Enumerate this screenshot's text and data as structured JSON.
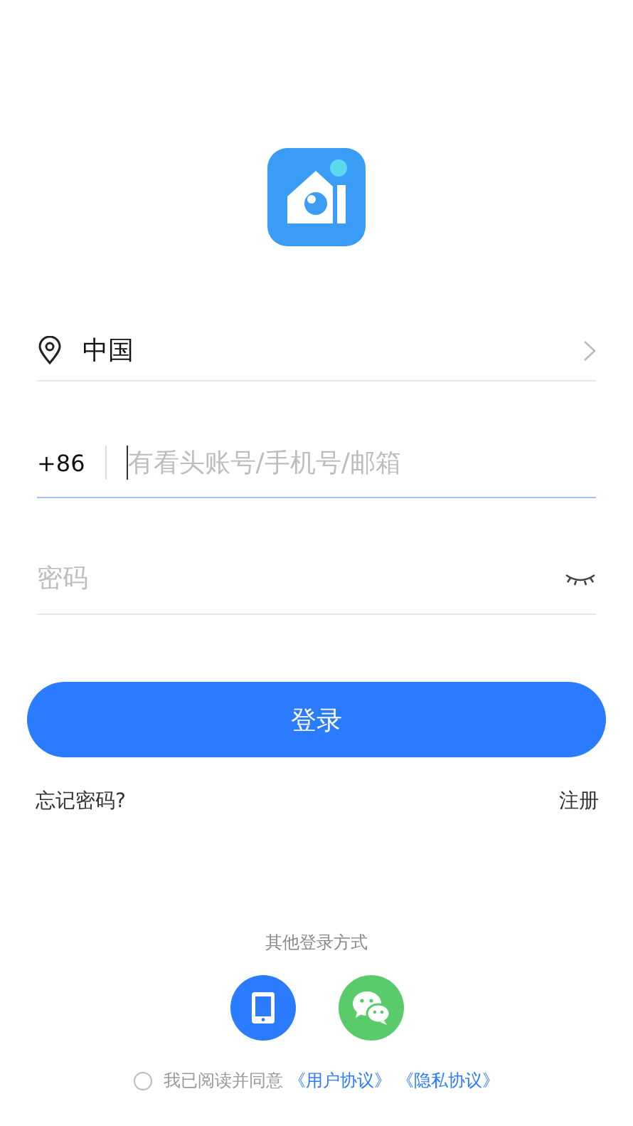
{
  "region": {
    "value": "中国"
  },
  "account": {
    "prefix": "+86",
    "placeholder": "有看头账号/手机号/邮箱",
    "focused": true
  },
  "password": {
    "placeholder": "密码",
    "visible": false
  },
  "login_button": {
    "label": "登录"
  },
  "forgot_link": "忘记密码?",
  "register_link": "注册",
  "other_login": {
    "title": "其他登录方式",
    "methods": [
      {
        "kind": "phone"
      },
      {
        "kind": "wechat"
      }
    ]
  },
  "agreement": {
    "checked": false,
    "text": "我已阅读并同意",
    "links": [
      "《用户协议》",
      "《隐私协议》"
    ]
  }
}
